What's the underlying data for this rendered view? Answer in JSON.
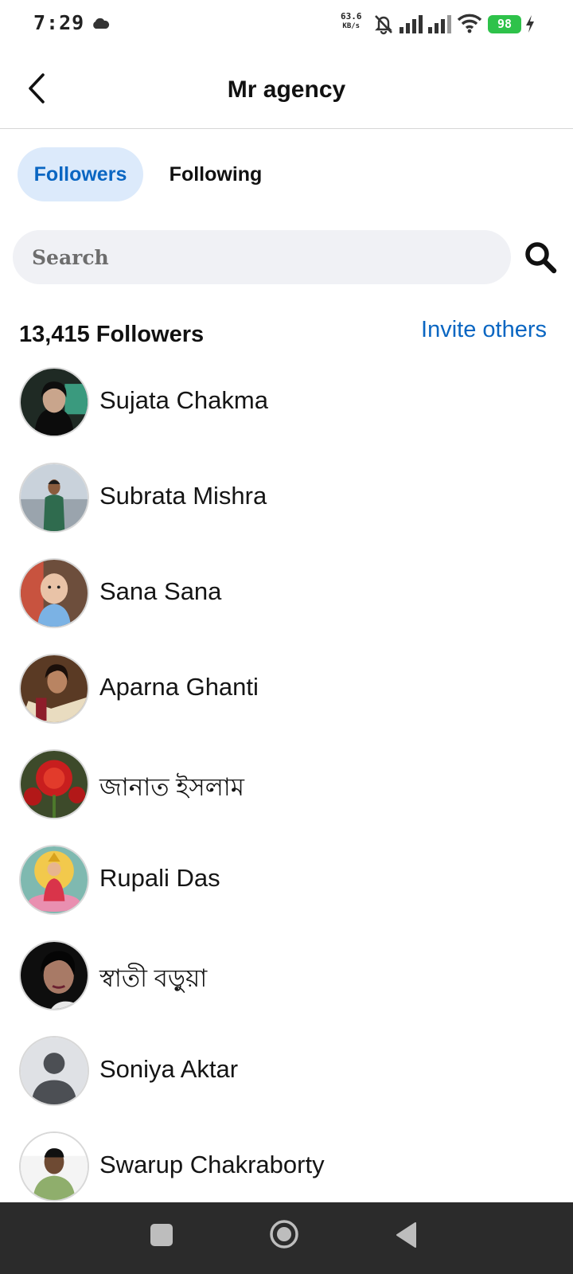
{
  "status_bar": {
    "time": "7:29",
    "net_speed_value": "63.6",
    "net_speed_unit": "KB/s",
    "battery": "98",
    "icons": [
      "cloud-icon",
      "bell-off-icon",
      "signal-icon",
      "signal-icon",
      "wifi-icon",
      "bolt-icon"
    ]
  },
  "header": {
    "title": "Mr agency",
    "back_icon": "chevron-left-icon"
  },
  "tabs": [
    {
      "label": "Followers",
      "active": true
    },
    {
      "label": "Following",
      "active": false
    }
  ],
  "search": {
    "placeholder": "Search",
    "icon": "search-icon"
  },
  "followers_count": "13,415 Followers",
  "invite_label": "Invite others",
  "followers": [
    {
      "name": "Sujata Chakma",
      "avatar": "photo"
    },
    {
      "name": "Subrata Mishra",
      "avatar": "photo"
    },
    {
      "name": "Sana Sana",
      "avatar": "photo"
    },
    {
      "name": "Aparna Ghanti",
      "avatar": "photo"
    },
    {
      "name": "জানাত ইসলাম",
      "avatar": "photo"
    },
    {
      "name": "Rupali Das",
      "avatar": "photo"
    },
    {
      "name": "স্বাতী বড়ুয়া",
      "avatar": "photo"
    },
    {
      "name": "Soniya Aktar",
      "avatar": "default-avatar-icon"
    },
    {
      "name": "Swarup Chakraborty",
      "avatar": "photo"
    }
  ],
  "colors": {
    "accent": "#0a66c2",
    "active_tab_bg": "#dceafb",
    "search_bg": "#f0f1f5",
    "battery": "#2ec24a",
    "nav_bar": "#2b2b2b"
  },
  "nav_bar": {
    "icons": [
      "recent-apps-icon",
      "home-icon",
      "back-icon"
    ]
  }
}
